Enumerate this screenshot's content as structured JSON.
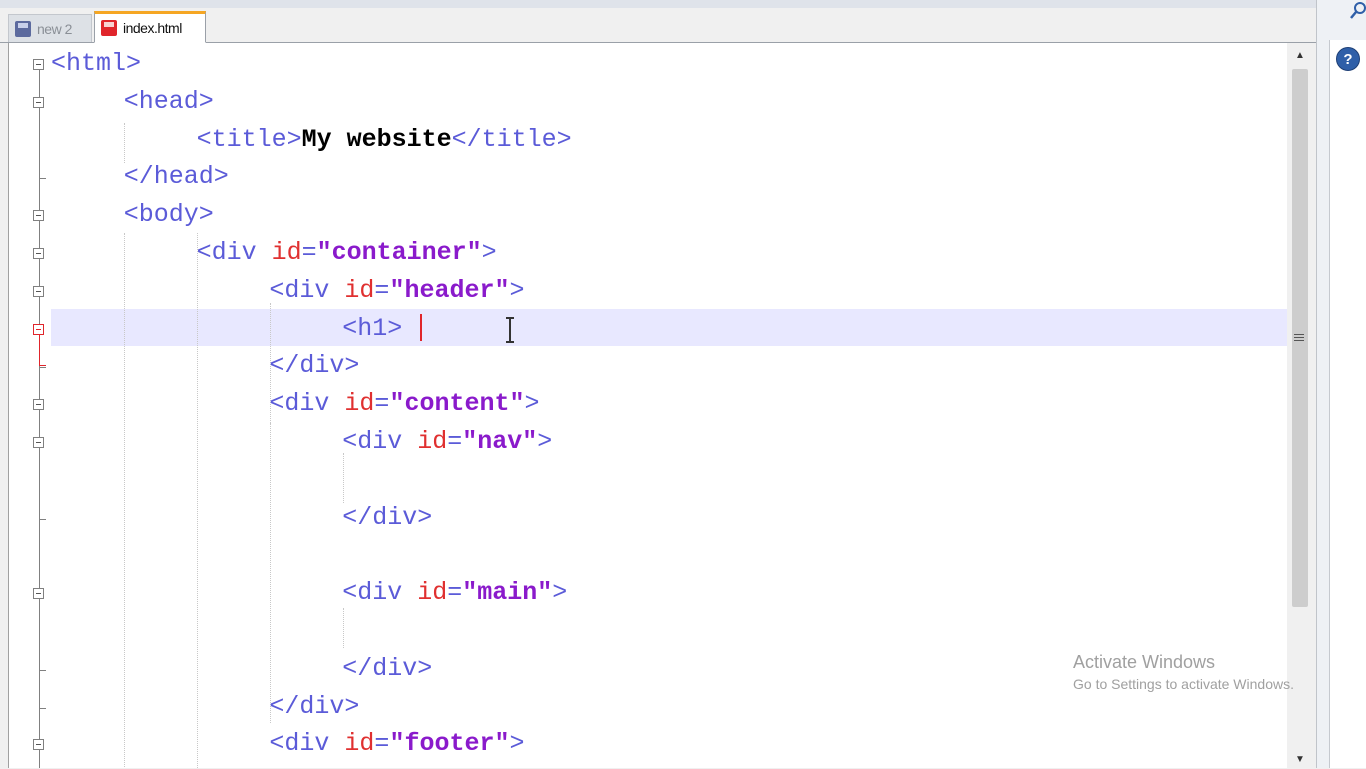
{
  "tabs": [
    {
      "label": "new  2",
      "icon": "floppy-disk-icon"
    },
    {
      "label": "index.html",
      "icon": "floppy-disk-red-icon"
    }
  ],
  "code_lines": [
    {
      "tokens": [
        [
          "tag",
          "<html>"
        ]
      ]
    },
    {
      "tokens": [
        [
          "tag",
          "<head>"
        ]
      ]
    },
    {
      "tokens": [
        [
          "tag",
          "<title>"
        ],
        [
          "txt",
          "My website"
        ],
        [
          "tag",
          "</title>"
        ]
      ]
    },
    {
      "tokens": [
        [
          "tag",
          "</head>"
        ]
      ]
    },
    {
      "tokens": [
        [
          "tag",
          "<body>"
        ]
      ]
    },
    {
      "tokens": [
        [
          "tag",
          "<div "
        ],
        [
          "attr",
          "id"
        ],
        [
          "eq",
          "="
        ],
        [
          "val",
          "\"container\""
        ],
        [
          "tag",
          ">"
        ]
      ]
    },
    {
      "tokens": [
        [
          "tag",
          "<div "
        ],
        [
          "attr",
          "id"
        ],
        [
          "eq",
          "="
        ],
        [
          "val",
          "\"header\""
        ],
        [
          "tag",
          ">"
        ]
      ]
    },
    {
      "tokens": [
        [
          "tag",
          "<h1>"
        ]
      ]
    },
    {
      "tokens": [
        [
          "tag",
          "</div>"
        ]
      ]
    },
    {
      "tokens": [
        [
          "tag",
          "<div "
        ],
        [
          "attr",
          "id"
        ],
        [
          "eq",
          "="
        ],
        [
          "val",
          "\"content\""
        ],
        [
          "tag",
          ">"
        ]
      ]
    },
    {
      "tokens": [
        [
          "tag",
          "<div "
        ],
        [
          "attr",
          "id"
        ],
        [
          "eq",
          "="
        ],
        [
          "val",
          "\"nav\""
        ],
        [
          "tag",
          ">"
        ]
      ]
    },
    {
      "tokens": []
    },
    {
      "tokens": [
        [
          "tag",
          "</div>"
        ]
      ]
    },
    {
      "tokens": []
    },
    {
      "tokens": [
        [
          "tag",
          "<div "
        ],
        [
          "attr",
          "id"
        ],
        [
          "eq",
          "="
        ],
        [
          "val",
          "\"main\""
        ],
        [
          "tag",
          ">"
        ]
      ]
    },
    {
      "tokens": []
    },
    {
      "tokens": [
        [
          "tag",
          "</div>"
        ]
      ]
    },
    {
      "tokens": [
        [
          "tag",
          "</div>"
        ]
      ]
    },
    {
      "tokens": [
        [
          "tag",
          "<div "
        ],
        [
          "attr",
          "id"
        ],
        [
          "eq",
          "="
        ],
        [
          "val",
          "\"footer\""
        ],
        [
          "tag",
          ">"
        ]
      ]
    }
  ],
  "watermark": {
    "title": "Activate Windows",
    "subtitle": "Go to Settings to activate Windows."
  },
  "right_panel": {
    "help_icon_label": "?"
  },
  "colors": {
    "tag": "#5b5bd8",
    "attribute": "#e03030",
    "attribute_value": "#8a1acb",
    "text": "#000000",
    "current_line_highlight": "#e8e8ff",
    "active_tab_accent": "#f5a623"
  }
}
